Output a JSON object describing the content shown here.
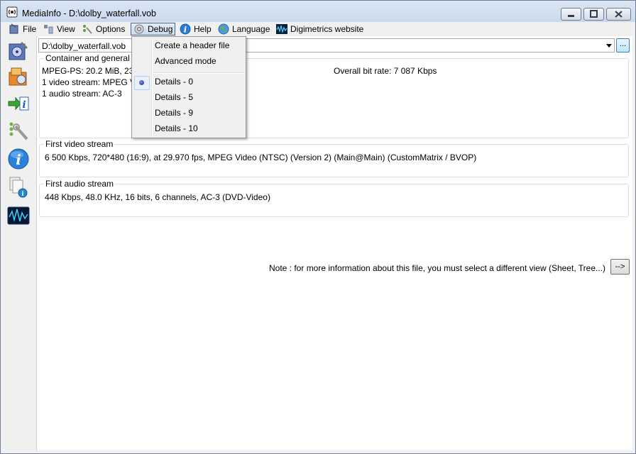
{
  "window": {
    "title": "MediaInfo - D:\\dolby_waterfall.vob"
  },
  "menu": {
    "file": "File",
    "view": "View",
    "options": "Options",
    "debug": "Debug",
    "help": "Help",
    "language": "Language",
    "website": "Digimetrics website"
  },
  "debug_menu": {
    "items": [
      "Create a header file",
      "Advanced mode",
      "Details - 0",
      "Details - 5",
      "Details - 9",
      "Details - 10"
    ],
    "selected": "Details - 0"
  },
  "file_combo": {
    "value": "D:\\dolby_waterfall.vob",
    "browse_label": "..."
  },
  "container": {
    "title": "Container and general information",
    "format_line": "MPEG-PS: 20.2 MiB, 23",
    "video_line": "1 video stream: MPEG Video",
    "audio_line": "1 audio stream: AC-3",
    "bitrate": "Overall bit rate: 7 087 Kbps"
  },
  "video": {
    "title": "First video stream",
    "details": "6 500 Kbps, 720*480 (16:9), at 29.970 fps, MPEG Video (NTSC) (Version 2) (Main@Main) (CustomMatrix / BVOP)"
  },
  "audio": {
    "title": "First audio stream",
    "details": "448 Kbps, 48.0 KHz, 16 bits, 6 channels, AC-3 (DVD-Video)"
  },
  "note": {
    "text": "Note : for more information about this file, you must select a different view (Sheet, Tree...)",
    "button": "-->"
  },
  "colors": {
    "menu_active_border": "#4b6587",
    "radio_selected": "#1b2d8c",
    "title_bar": "#dbe6f4"
  }
}
